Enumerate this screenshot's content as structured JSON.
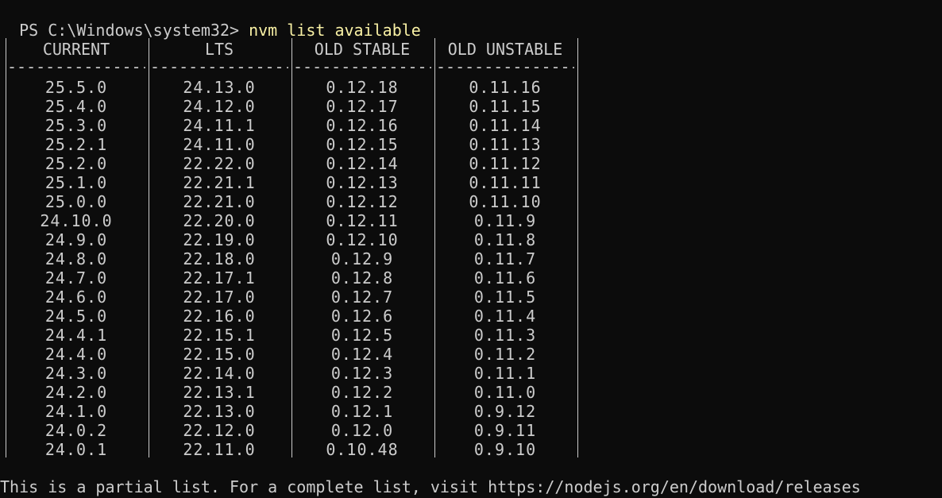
{
  "terminal": {
    "prompt": "PS C:\\Windows\\system32> ",
    "command": "nvm list available",
    "footer": "This is a partial list. For a complete list, visit https://nodejs.org/en/download/releases"
  },
  "table": {
    "columns": [
      "CURRENT",
      "LTS",
      "OLD STABLE",
      "OLD UNSTABLE"
    ],
    "rule": "---------------",
    "rows": [
      [
        "25.5.0",
        "24.13.0",
        "0.12.18",
        "0.11.16"
      ],
      [
        "25.4.0",
        "24.12.0",
        "0.12.17",
        "0.11.15"
      ],
      [
        "25.3.0",
        "24.11.1",
        "0.12.16",
        "0.11.14"
      ],
      [
        "25.2.1",
        "24.11.0",
        "0.12.15",
        "0.11.13"
      ],
      [
        "25.2.0",
        "22.22.0",
        "0.12.14",
        "0.11.12"
      ],
      [
        "25.1.0",
        "22.21.1",
        "0.12.13",
        "0.11.11"
      ],
      [
        "25.0.0",
        "22.21.0",
        "0.12.12",
        "0.11.10"
      ],
      [
        "24.10.0",
        "22.20.0",
        "0.12.11",
        "0.11.9"
      ],
      [
        "24.9.0",
        "22.19.0",
        "0.12.10",
        "0.11.8"
      ],
      [
        "24.8.0",
        "22.18.0",
        "0.12.9",
        "0.11.7"
      ],
      [
        "24.7.0",
        "22.17.1",
        "0.12.8",
        "0.11.6"
      ],
      [
        "24.6.0",
        "22.17.0",
        "0.12.7",
        "0.11.5"
      ],
      [
        "24.5.0",
        "22.16.0",
        "0.12.6",
        "0.11.4"
      ],
      [
        "24.4.1",
        "22.15.1",
        "0.12.5",
        "0.11.3"
      ],
      [
        "24.4.0",
        "22.15.0",
        "0.12.4",
        "0.11.2"
      ],
      [
        "24.3.0",
        "22.14.0",
        "0.12.3",
        "0.11.1"
      ],
      [
        "24.2.0",
        "22.13.1",
        "0.12.2",
        "0.11.0"
      ],
      [
        "24.1.0",
        "22.13.0",
        "0.12.1",
        "0.9.12"
      ],
      [
        "24.0.2",
        "22.12.0",
        "0.12.0",
        "0.9.11"
      ],
      [
        "24.0.1",
        "22.11.0",
        "0.10.48",
        "0.9.10"
      ]
    ]
  },
  "colors": {
    "background": "#0c0c0c",
    "text": "#cccccc",
    "command": "#f9f1a5"
  }
}
